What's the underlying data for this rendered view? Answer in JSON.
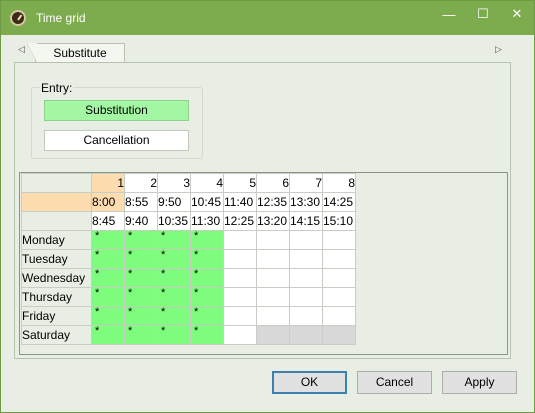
{
  "window": {
    "title": "Time grid",
    "icon": "clock-icon"
  },
  "tabs": [
    {
      "label": "Substitute"
    }
  ],
  "entry": {
    "label": "Entry:",
    "options": [
      "Substitution",
      "Cancellation"
    ],
    "selected": "Substitution"
  },
  "grid": {
    "periods": [
      "1",
      "2",
      "3",
      "4",
      "5",
      "6",
      "7",
      "8"
    ],
    "start_times": [
      "8:00",
      "8:55",
      "9:50",
      "10:45",
      "11:40",
      "12:35",
      "13:30",
      "14:25"
    ],
    "end_times": [
      "8:45",
      "9:40",
      "10:35",
      "11:30",
      "12:25",
      "13:20",
      "14:15",
      "15:10"
    ],
    "days": [
      "Monday",
      "Tuesday",
      "Wednesday",
      "Thursday",
      "Friday",
      "Saturday"
    ],
    "cell_mark": "*",
    "rows": [
      [
        "green",
        "green",
        "green",
        "green",
        "white",
        "white",
        "white",
        "white"
      ],
      [
        "green",
        "green",
        "green",
        "green",
        "white",
        "white",
        "white",
        "white"
      ],
      [
        "green",
        "green",
        "green",
        "green",
        "white",
        "white",
        "white",
        "white"
      ],
      [
        "green",
        "green",
        "green",
        "green",
        "white",
        "white",
        "white",
        "white"
      ],
      [
        "green",
        "green",
        "green",
        "green",
        "white",
        "white",
        "white",
        "white"
      ],
      [
        "green",
        "green",
        "green",
        "green",
        "white",
        "gray",
        "gray",
        "gray"
      ]
    ],
    "colors": {
      "green": "#7dfc7d",
      "selected": "#fddcb0",
      "gray": "#d8d8d8"
    }
  },
  "buttons": {
    "ok": "OK",
    "cancel": "Cancel",
    "apply": "Apply"
  }
}
